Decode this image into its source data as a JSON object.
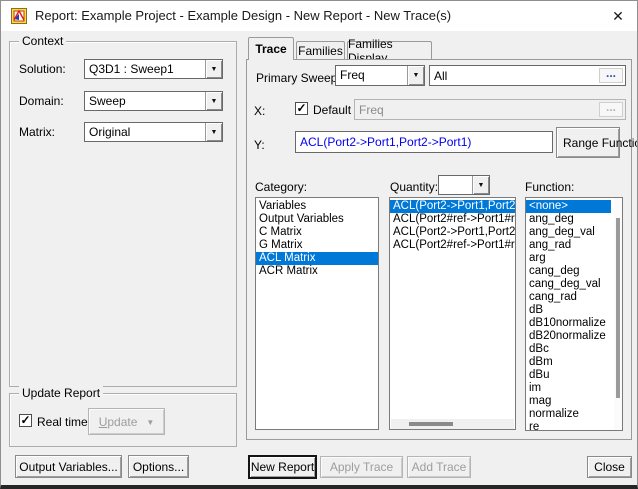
{
  "window": {
    "title": "Report: Example Project - Example Design - New Report - New Trace(s)"
  },
  "icons": {
    "close": "✕",
    "dropdown": "▼",
    "check": "✓",
    "ellipsis": "..."
  },
  "context": {
    "group_label": "Context",
    "solution_label": "Solution:",
    "solution_value": "Q3D1 : Sweep1",
    "domain_label": "Domain:",
    "domain_value": "Sweep",
    "matrix_label": "Matrix:",
    "matrix_value": "Original"
  },
  "tabs": {
    "trace": "Trace",
    "families": "Families",
    "families_display": "Families Display"
  },
  "trace_tab": {
    "primary_sweep_label": "Primary Sweep:",
    "primary_sweep_value": "Freq",
    "sweep_range_value": "All",
    "x_label": "X:",
    "x_default_label": "Default",
    "x_value": "Freq",
    "y_label": "Y:",
    "y_value": "ACL(Port2->Port1,Port2->Port1)",
    "range_function_button": "Range Function...",
    "category_label": "Category:",
    "quantity_label": "Quantity:",
    "quantity_combo_value": "",
    "function_label": "Function:",
    "categories": [
      "Variables",
      "Output Variables",
      "C Matrix",
      "G Matrix",
      "ACL Matrix",
      "ACR Matrix"
    ],
    "selected_category_index": 4,
    "quantities": [
      "ACL(Port2->Port1,Port2",
      "ACL(Port2#ref->Port1#r",
      "ACL(Port2->Port1,Port2",
      "ACL(Port2#ref->Port1#r"
    ],
    "selected_quantity_index": 0,
    "functions": [
      "<none>",
      "ang_deg",
      "ang_deg_val",
      "ang_rad",
      "arg",
      "cang_deg",
      "cang_deg_val",
      "cang_rad",
      "dB",
      "dB10normalize",
      "dB20normalize",
      "dBc",
      "dBm",
      "dBu",
      "im",
      "mag",
      "normalize",
      "re"
    ],
    "selected_function_index": 0
  },
  "update_report": {
    "group_label": "Update Report",
    "real_time_label": "Real time",
    "update_accel": "U",
    "update_rest": "pdate"
  },
  "footer": {
    "output_variables": "Output Variables...",
    "options": "Options...",
    "new_report": "New Report",
    "apply_trace": "Apply Trace",
    "add_trace": "Add Trace",
    "close": "Close"
  },
  "colors": {
    "selection": "#0078d7",
    "y_value_text": "#0000ee",
    "disabled_text": "#9d9d9d",
    "dialog_background": "#f0f0f0",
    "titlebar_background": "#ffffff"
  }
}
